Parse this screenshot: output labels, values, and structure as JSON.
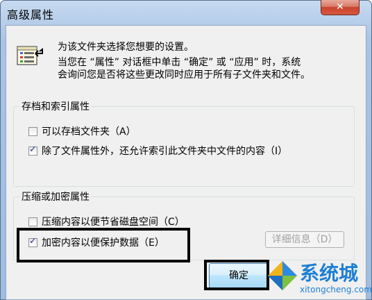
{
  "window": {
    "title": "高级属性",
    "close_label": "✕"
  },
  "intro": {
    "line1": "为该文件夹选择您想要的设置。",
    "line2": "当您在 “属性” 对话框中单击 “确定” 或 “应用” 时，系统",
    "line3": "会询问您是否将这些更改同时应用于所有子文件夹和文件。"
  },
  "archive_group": {
    "label": "存档和索引属性",
    "options": [
      {
        "label": "可以存档文件夹（A）",
        "checked": false
      },
      {
        "label": "除了文件属性外，还允许索引此文件夹中文件的内容（I）",
        "checked": true
      }
    ]
  },
  "compress_group": {
    "label": "压缩或加密属性",
    "options": [
      {
        "label": "压缩内容以便节省磁盘空间（C）",
        "checked": false
      },
      {
        "label": "加密内容以便保护数据（E）",
        "checked": true
      }
    ],
    "details_label": "详细信息（D）"
  },
  "buttons": {
    "ok_label": "确定"
  },
  "watermark": {
    "text": "系统城",
    "url": "xitongcheng.com"
  }
}
